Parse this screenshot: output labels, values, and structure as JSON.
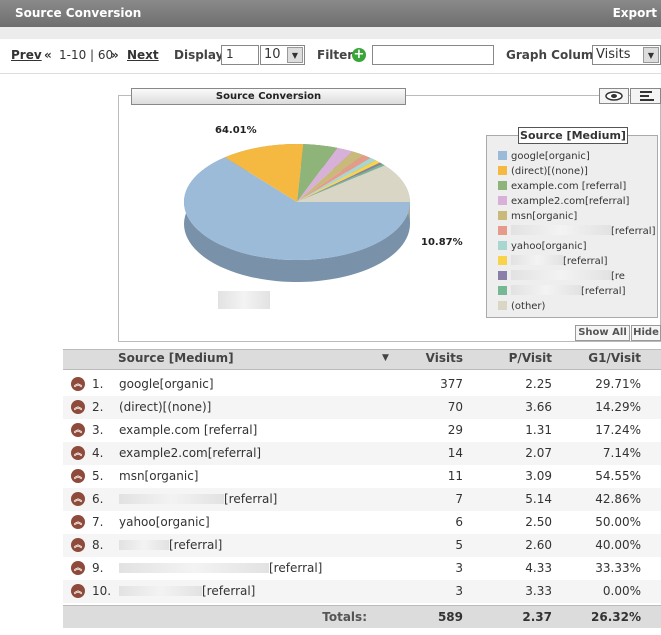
{
  "header": {
    "title": "Source Conversion",
    "export_label": "Export"
  },
  "pager": {
    "prev": "Prev",
    "range": "1-10 | 60",
    "next": "Next",
    "prev_icon": "«",
    "next_icon": "»"
  },
  "display": {
    "label": "Display",
    "start": "1",
    "count": "10"
  },
  "filter": {
    "label": "Filter",
    "value": ""
  },
  "graph": {
    "label": "Graph Column",
    "value": "Visits"
  },
  "chart": {
    "title": "Source Conversion",
    "legend_title": "Source [Medium]",
    "label_big": "64.01%",
    "label_other": "10.87%",
    "show_all": "Show All",
    "hide": "Hide",
    "legend": [
      {
        "label": "google[organic]",
        "color": "#9bbbd9"
      },
      {
        "label": "(direct)[(none)]",
        "color": "#f5b942"
      },
      {
        "label": "example.com [referral]",
        "color": "#8fb47a"
      },
      {
        "label": "example2.com[referral]",
        "color": "#d7b1d8"
      },
      {
        "label": "msn[organic]",
        "color": "#c9b97a"
      },
      {
        "label": "[referral]",
        "color": "#e69a8a"
      },
      {
        "label": "yahoo[organic]",
        "color": "#a9d6d1"
      },
      {
        "label": "[referral]",
        "color": "#f7d44a"
      },
      {
        "label": "[re",
        "color": "#8a7fa8"
      },
      {
        "label": "[referral]",
        "color": "#74b894"
      },
      {
        "label": "(other)",
        "color": "#d9d6c6"
      }
    ]
  },
  "table": {
    "headers": {
      "source": "Source [Medium]",
      "visits": "Visits",
      "pvisit": "P/Visit",
      "g1": "G1/Visit",
      "sort_icon": "▼"
    },
    "rows": [
      {
        "n": "1.",
        "source": "google[organic]",
        "visits": "377",
        "pvisit": "2.25",
        "g1": "29.71%"
      },
      {
        "n": "2.",
        "source": "(direct)[(none)]",
        "visits": "70",
        "pvisit": "3.66",
        "g1": "14.29%"
      },
      {
        "n": "3.",
        "source": "example.com [referral]",
        "visits": "29",
        "pvisit": "1.31",
        "g1": "17.24%"
      },
      {
        "n": "4.",
        "source": "example2.com[referral]",
        "visits": "14",
        "pvisit": "2.07",
        "g1": "7.14%"
      },
      {
        "n": "5.",
        "source": "msn[organic]",
        "visits": "11",
        "pvisit": "3.09",
        "g1": "54.55%"
      },
      {
        "n": "6.",
        "source": "[referral]",
        "visits": "7",
        "pvisit": "5.14",
        "g1": "42.86%"
      },
      {
        "n": "7.",
        "source": "yahoo[organic]",
        "visits": "6",
        "pvisit": "2.50",
        "g1": "50.00%"
      },
      {
        "n": "8.",
        "source": "[referral]",
        "visits": "5",
        "pvisit": "2.60",
        "g1": "40.00%"
      },
      {
        "n": "9.",
        "source": "[referral]",
        "visits": "3",
        "pvisit": "4.33",
        "g1": "33.33%"
      },
      {
        "n": "10.",
        "source": "[referral]",
        "visits": "3",
        "pvisit": "3.33",
        "g1": "0.00%"
      }
    ],
    "totals": {
      "label": "Totals:",
      "visits": "589",
      "pvisit": "2.37",
      "g1": "26.32%"
    }
  }
}
